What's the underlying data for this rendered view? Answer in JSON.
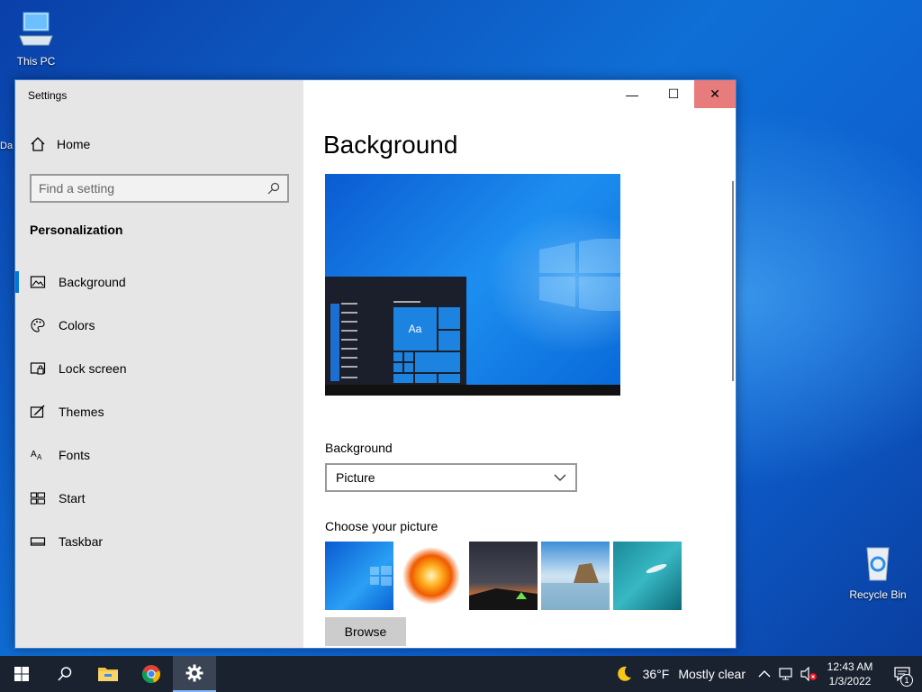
{
  "desktop": {
    "this_pc_label": "This PC",
    "clipped_label": "Da",
    "recycle_bin_label": "Recycle Bin"
  },
  "window": {
    "title": "Settings",
    "controls": {
      "minimize": "—",
      "maximize": "☐",
      "close": "✕"
    }
  },
  "nav": {
    "home_label": "Home",
    "search_placeholder": "Find a setting",
    "section_title": "Personalization",
    "items": [
      {
        "label": "Background",
        "icon": "picture-icon",
        "active": true
      },
      {
        "label": "Colors",
        "icon": "palette-icon"
      },
      {
        "label": "Lock screen",
        "icon": "lock-screen-icon"
      },
      {
        "label": "Themes",
        "icon": "themes-icon"
      },
      {
        "label": "Fonts",
        "icon": "fonts-icon"
      },
      {
        "label": "Start",
        "icon": "start-icon"
      },
      {
        "label": "Taskbar",
        "icon": "taskbar-icon"
      }
    ]
  },
  "content": {
    "page_title": "Background",
    "preview_tile_text": "Aa",
    "background_label": "Background",
    "background_value": "Picture",
    "choose_label": "Choose your picture",
    "browse_label": "Browse"
  },
  "taskbar": {
    "weather_temp": "36°F",
    "weather_desc": "Mostly clear",
    "time": "12:43 AM",
    "date": "1/3/2022",
    "notification_count": "1"
  },
  "colors": {
    "accent": "#0078d7",
    "nav_bg": "#e6e6e6",
    "close_hover": "#e87b7b",
    "taskbar_bg": "#1a2230"
  }
}
